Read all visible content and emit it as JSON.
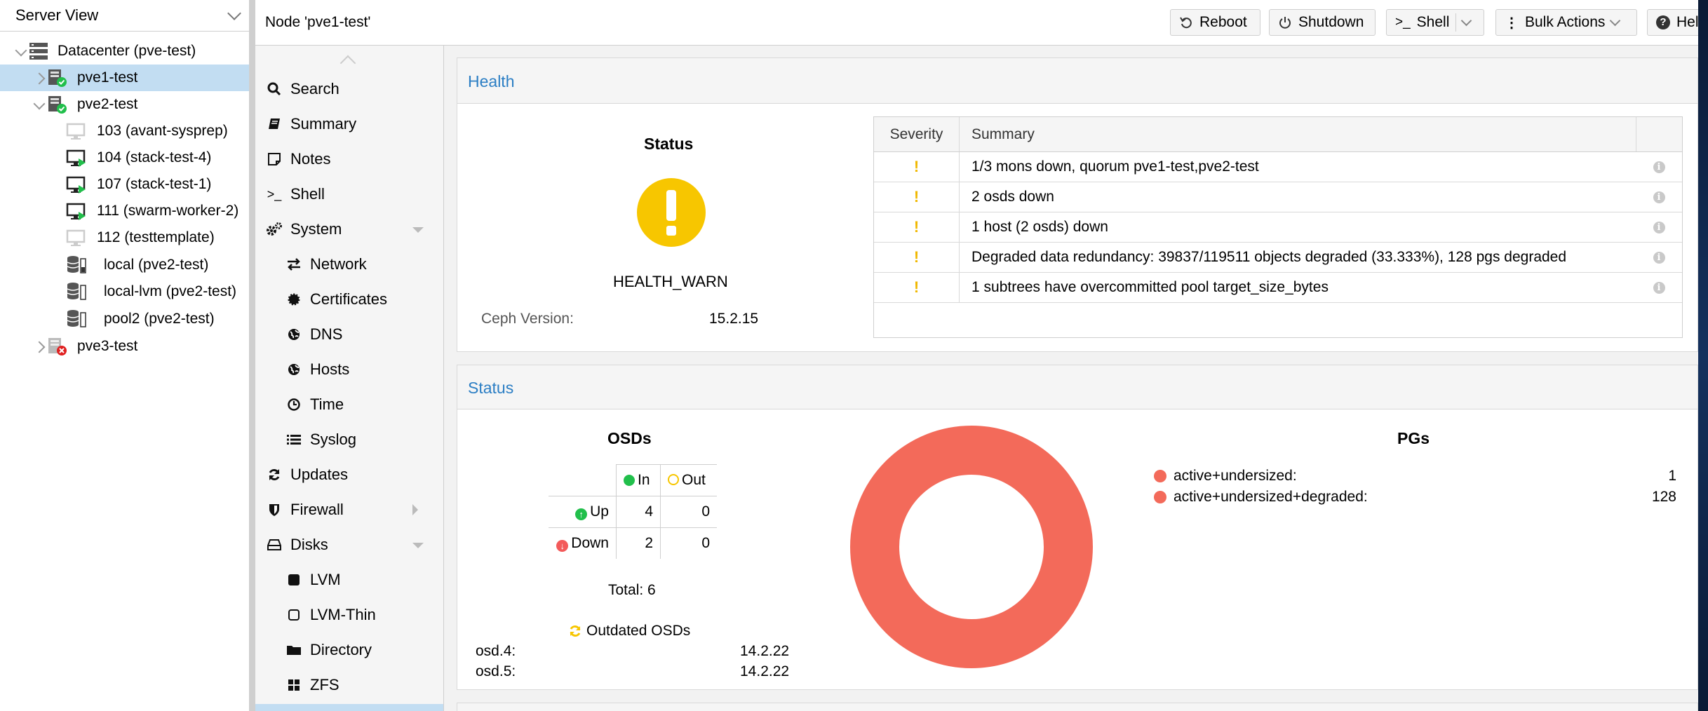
{
  "tree": {
    "view_label": "Server View",
    "nodes": [
      {
        "label": "Datacenter (pve-test)",
        "icon": "datacenter-icon"
      },
      {
        "label": "pve1-test",
        "icon": "node-online-icon",
        "selected": true
      },
      {
        "label": "pve2-test",
        "icon": "node-online-icon"
      },
      {
        "label": "103 (avant-sysprep)",
        "icon": "vm-template-icon"
      },
      {
        "label": "104 (stack-test-4)",
        "icon": "vm-running-icon"
      },
      {
        "label": "107 (stack-test-1)",
        "icon": "vm-running-icon"
      },
      {
        "label": "111 (swarm-worker-2)",
        "icon": "vm-running-icon"
      },
      {
        "label": "112 (testtemplate)",
        "icon": "vm-template-icon"
      },
      {
        "label": "local (pve2-test)",
        "icon": "storage-icon"
      },
      {
        "label": "local-lvm (pve2-test)",
        "icon": "storage-icon"
      },
      {
        "label": "pool2 (pve2-test)",
        "icon": "storage-icon"
      },
      {
        "label": "pve3-test",
        "icon": "node-offline-icon"
      }
    ]
  },
  "header": {
    "title": "Node 'pve1-test'",
    "buttons": {
      "reboot": "Reboot",
      "shutdown": "Shutdown",
      "shell": "Shell",
      "bulk": "Bulk Actions",
      "help": "Hel"
    }
  },
  "nav": [
    {
      "label": "Search",
      "icon": "search-icon"
    },
    {
      "label": "Summary",
      "icon": "book-icon"
    },
    {
      "label": "Notes",
      "icon": "note-icon"
    },
    {
      "label": "Shell",
      "icon": "terminal-icon"
    },
    {
      "label": "System",
      "icon": "cogs-icon"
    },
    {
      "label": "Network",
      "icon": "network-icon"
    },
    {
      "label": "Certificates",
      "icon": "certificate-icon"
    },
    {
      "label": "DNS",
      "icon": "globe-icon"
    },
    {
      "label": "Hosts",
      "icon": "globe-icon"
    },
    {
      "label": "Time",
      "icon": "clock-icon"
    },
    {
      "label": "Syslog",
      "icon": "list-icon"
    },
    {
      "label": "Updates",
      "icon": "refresh-icon"
    },
    {
      "label": "Firewall",
      "icon": "shield-icon"
    },
    {
      "label": "Disks",
      "icon": "hdd-icon"
    },
    {
      "label": "LVM",
      "icon": "square-icon"
    },
    {
      "label": "LVM-Thin",
      "icon": "square-outline-icon"
    },
    {
      "label": "Directory",
      "icon": "folder-icon"
    },
    {
      "label": "ZFS",
      "icon": "grid-icon"
    }
  ],
  "health": {
    "title": "Health",
    "status_heading": "Status",
    "status_value": "HEALTH_WARN",
    "ceph_version_label": "Ceph Version:",
    "ceph_version": "15.2.15",
    "columns": {
      "severity": "Severity",
      "summary": "Summary"
    },
    "rows": [
      {
        "severity": "!",
        "summary": "1/3 mons down, quorum pve1-test,pve2-test"
      },
      {
        "severity": "!",
        "summary": "2 osds down"
      },
      {
        "severity": "!",
        "summary": "1 host (2 osds) down"
      },
      {
        "severity": "!",
        "summary": "Degraded data redundancy: 39837/119511 objects degraded (33.333%), 128 pgs degraded"
      },
      {
        "severity": "!",
        "summary": "1 subtrees have overcommitted pool target_size_bytes"
      }
    ]
  },
  "status": {
    "title": "Status",
    "osds": {
      "heading": "OSDs",
      "col_in": "In",
      "col_out": "Out",
      "row_up": "Up",
      "row_down": "Down",
      "up_in": "4",
      "up_out": "0",
      "down_in": "2",
      "down_out": "0",
      "total": "Total: 6",
      "outdated_label": "Outdated OSDs",
      "outdated": [
        {
          "name": "osd.4:",
          "version": "14.2.22"
        },
        {
          "name": "osd.5:",
          "version": "14.2.22"
        }
      ]
    },
    "pgs": {
      "heading": "PGs",
      "items": [
        {
          "label": "active+undersized:",
          "value": "1"
        },
        {
          "label": "active+undersized+degraded:",
          "value": "128"
        }
      ],
      "color": "#f36a5a"
    }
  }
}
